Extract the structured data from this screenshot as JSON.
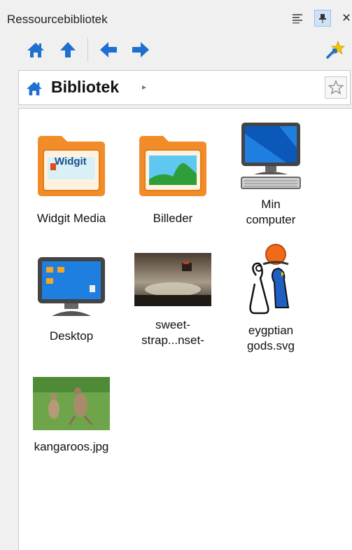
{
  "window": {
    "title": "Ressourcebibliotek"
  },
  "title_buttons": {
    "menu_icon": "menu-icon",
    "pin_icon": "pin-icon",
    "close_label": "×"
  },
  "toolbar": {
    "home_icon": "home-icon",
    "up_icon": "arrow-up-icon",
    "back_icon": "arrow-left-icon",
    "forward_icon": "arrow-right-icon",
    "favorite_icon": "star-add-icon"
  },
  "path": {
    "current": "Bibliotek",
    "arrow": "▸"
  },
  "colors": {
    "accent_blue": "#1e7fe0",
    "folder_orange": "#f28c28"
  },
  "items": [
    {
      "name": "Widgit Media",
      "line1": "Widgit Media",
      "line2": "",
      "icon": "widgit-folder-icon"
    },
    {
      "name": "Billeder",
      "line1": "Billeder",
      "line2": "",
      "icon": "pictures-folder-icon"
    },
    {
      "name": "Min computer",
      "line1": "Min",
      "line2": "computer",
      "icon": "computer-icon"
    },
    {
      "name": "Desktop",
      "line1": "Desktop",
      "line2": "",
      "icon": "desktop-icon"
    },
    {
      "name": "sweet-strap...nset-",
      "line1": "sweet-",
      "line2": "strap...nset-",
      "icon": "photo-thumbnail"
    },
    {
      "name": "eygptian gods.svg",
      "line1": "eygptian",
      "line2": "gods.svg",
      "icon": "egyptian-god-symbol"
    },
    {
      "name": "kangaroos.jpg",
      "line1": "kangaroos.jpg",
      "line2": "",
      "icon": "kangaroo-photo-thumbnail"
    }
  ],
  "widgit_text": "Widgit"
}
